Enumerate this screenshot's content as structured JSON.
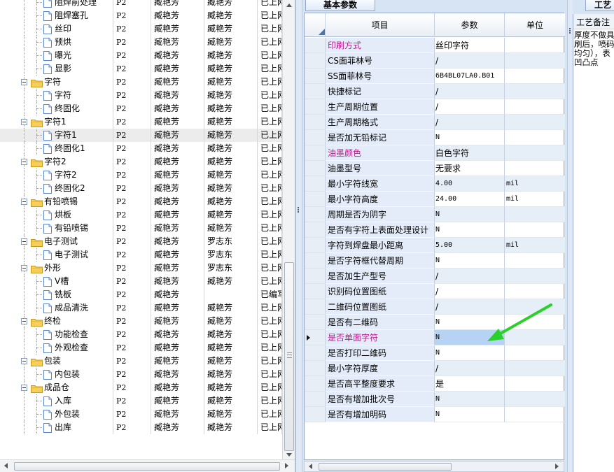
{
  "tree_rows": [
    {
      "label": "阻焊前处理",
      "level": 2,
      "icon": "doc",
      "c1": "P2",
      "c2": "臧艳芳",
      "c3": "臧艳芳",
      "c4": "已上网"
    },
    {
      "label": "阻焊塞孔",
      "level": 2,
      "icon": "doc",
      "c1": "P2",
      "c2": "臧艳芳",
      "c3": "臧艳芳",
      "c4": "已上网"
    },
    {
      "label": "丝印",
      "level": 2,
      "icon": "doc",
      "c1": "P2",
      "c2": "臧艳芳",
      "c3": "臧艳芳",
      "c4": "已上网"
    },
    {
      "label": "预烘",
      "level": 2,
      "icon": "doc",
      "c1": "P2",
      "c2": "臧艳芳",
      "c3": "臧艳芳",
      "c4": "已上网"
    },
    {
      "label": "曝光",
      "level": 2,
      "icon": "doc",
      "c1": "P2",
      "c2": "臧艳芳",
      "c3": "臧艳芳",
      "c4": "已上网"
    },
    {
      "label": "显影",
      "level": 2,
      "icon": "doc",
      "c1": "P2",
      "c2": "臧艳芳",
      "c3": "臧艳芳",
      "c4": "已上网"
    },
    {
      "label": "字符",
      "level": 1,
      "icon": "folder",
      "c1": "P2",
      "c2": "臧艳芳",
      "c3": "臧艳芳",
      "c4": "已上网"
    },
    {
      "label": "字符",
      "level": 2,
      "icon": "doc",
      "c1": "P2",
      "c2": "臧艳芳",
      "c3": "臧艳芳",
      "c4": "已上网"
    },
    {
      "label": "终固化",
      "level": 2,
      "icon": "doc",
      "c1": "P2",
      "c2": "臧艳芳",
      "c3": "臧艳芳",
      "c4": "已上网"
    },
    {
      "label": "字符1",
      "level": 1,
      "icon": "folder",
      "c1": "P2",
      "c2": "臧艳芳",
      "c3": "臧艳芳",
      "c4": "已上网"
    },
    {
      "label": "字符1",
      "level": 2,
      "icon": "doc",
      "c1": "P2",
      "c2": "臧艳芳",
      "c3": "臧艳芳",
      "c4": "已上网",
      "selected": true
    },
    {
      "label": "终固化1",
      "level": 2,
      "icon": "doc",
      "c1": "P2",
      "c2": "臧艳芳",
      "c3": "臧艳芳",
      "c4": "已上网"
    },
    {
      "label": "字符2",
      "level": 1,
      "icon": "folder",
      "c1": "P2",
      "c2": "臧艳芳",
      "c3": "臧艳芳",
      "c4": "已上网"
    },
    {
      "label": "字符2",
      "level": 2,
      "icon": "doc",
      "c1": "P2",
      "c2": "臧艳芳",
      "c3": "臧艳芳",
      "c4": "已上网"
    },
    {
      "label": "终固化2",
      "level": 2,
      "icon": "doc",
      "c1": "P2",
      "c2": "臧艳芳",
      "c3": "臧艳芳",
      "c4": "已上网"
    },
    {
      "label": "有铅喷锡",
      "level": 1,
      "icon": "folder",
      "c1": "P2",
      "c2": "臧艳芳",
      "c3": "臧艳芳",
      "c4": "已上网"
    },
    {
      "label": "烘板",
      "level": 2,
      "icon": "doc",
      "c1": "P2",
      "c2": "臧艳芳",
      "c3": "臧艳芳",
      "c4": "已上网"
    },
    {
      "label": "有铅喷锡",
      "level": 2,
      "icon": "doc",
      "c1": "P2",
      "c2": "臧艳芳",
      "c3": "臧艳芳",
      "c4": "已上网"
    },
    {
      "label": "电子测试",
      "level": 1,
      "icon": "folder",
      "c1": "P2",
      "c2": "臧艳芳",
      "c3": "罗志东",
      "c4": "已上网"
    },
    {
      "label": "电子测试",
      "level": 2,
      "icon": "doc",
      "c1": "P2",
      "c2": "臧艳芳",
      "c3": "罗志东",
      "c4": "已上网"
    },
    {
      "label": "外形",
      "level": 1,
      "icon": "folder",
      "c1": "P2",
      "c2": "臧艳芳",
      "c3": "罗志东",
      "c4": "已上网"
    },
    {
      "label": "V槽",
      "level": 2,
      "icon": "doc",
      "c1": "P2",
      "c2": "臧艳芳",
      "c3": "臧艳芳",
      "c4": "已上网"
    },
    {
      "label": "铣板",
      "level": 2,
      "icon": "doc",
      "c1": "P2",
      "c2": "臧艳芳",
      "c3": "",
      "c4": "已编写"
    },
    {
      "label": "成品清洗",
      "level": 2,
      "icon": "doc",
      "c1": "P2",
      "c2": "臧艳芳",
      "c3": "臧艳芳",
      "c4": "已上网"
    },
    {
      "label": "终检",
      "level": 1,
      "icon": "folder",
      "c1": "P2",
      "c2": "臧艳芳",
      "c3": "臧艳芳",
      "c4": "已上网"
    },
    {
      "label": "功能检查",
      "level": 2,
      "icon": "doc",
      "c1": "P2",
      "c2": "臧艳芳",
      "c3": "臧艳芳",
      "c4": "已上网"
    },
    {
      "label": "外观检查",
      "level": 2,
      "icon": "doc",
      "c1": "P2",
      "c2": "臧艳芳",
      "c3": "臧艳芳",
      "c4": "已上网"
    },
    {
      "label": "包装",
      "level": 1,
      "icon": "folder",
      "c1": "P2",
      "c2": "臧艳芳",
      "c3": "臧艳芳",
      "c4": "已上网"
    },
    {
      "label": "内包装",
      "level": 2,
      "icon": "doc",
      "c1": "P2",
      "c2": "臧艳芳",
      "c3": "臧艳芳",
      "c4": "已上网"
    },
    {
      "label": "成品仓",
      "level": 1,
      "icon": "folder",
      "c1": "P2",
      "c2": "臧艳芳",
      "c3": "臧艳芳",
      "c4": "已上网"
    },
    {
      "label": "入库",
      "level": 2,
      "icon": "doc",
      "c1": "P2",
      "c2": "臧艳芳",
      "c3": "臧艳芳",
      "c4": "已上网"
    },
    {
      "label": "外包装",
      "level": 2,
      "icon": "doc",
      "c1": "P2",
      "c2": "臧艳芳",
      "c3": "臧艳芳",
      "c4": "已上网"
    },
    {
      "label": "出库",
      "level": 2,
      "icon": "doc",
      "c1": "P2",
      "c2": "臧艳芳",
      "c3": "臧艳芳",
      "c4": "已上网"
    }
  ],
  "center": {
    "tab_label": "基本参数",
    "headers": {
      "item": "项目",
      "param": "参数",
      "unit": "单位"
    },
    "rows": [
      {
        "item": "印刷方式",
        "value": "丝印字符",
        "unit": "",
        "pink": true
      },
      {
        "item": "CS面菲林号",
        "value": "/",
        "unit": ""
      },
      {
        "item": "SS面菲林号",
        "value": "6B4BL07LA0.B01",
        "unit": "",
        "mono": true
      },
      {
        "item": "快捷标记",
        "value": "/",
        "unit": ""
      },
      {
        "item": "生产周期位置",
        "value": "/",
        "unit": ""
      },
      {
        "item": "生产周期格式",
        "value": "/",
        "unit": ""
      },
      {
        "item": "是否加无铅标记",
        "value": "N",
        "unit": "",
        "mono": true
      },
      {
        "item": "油墨颜色",
        "value": "白色字符",
        "unit": "",
        "pink": true
      },
      {
        "item": "油墨型号",
        "value": "无要求",
        "unit": ""
      },
      {
        "item": "最小字符线宽",
        "value": "4.00",
        "unit": "mil",
        "mono": true
      },
      {
        "item": "最小字符高度",
        "value": "24.00",
        "unit": "mil",
        "mono": true
      },
      {
        "item": "周期是否为阴字",
        "value": "N",
        "unit": "",
        "mono": true
      },
      {
        "item": "是否有字符上表面处理设计",
        "value": "N",
        "unit": "",
        "mono": true
      },
      {
        "item": "字符到焊盘最小距离",
        "value": "5.00",
        "unit": "mil",
        "mono": true
      },
      {
        "item": "是否字符框代替周期",
        "value": "N",
        "unit": "",
        "mono": true
      },
      {
        "item": "是否加生产型号",
        "value": "/",
        "unit": ""
      },
      {
        "item": "识别码位置图纸",
        "value": "/",
        "unit": ""
      },
      {
        "item": "二维码位置图纸",
        "value": "/",
        "unit": ""
      },
      {
        "item": "是否有二维码",
        "value": "N",
        "unit": "",
        "mono": true
      },
      {
        "item": "是否单面字符",
        "value": "N",
        "unit": "",
        "mono": true,
        "pink": true,
        "selected": true
      },
      {
        "item": "是否打印二维码",
        "value": "N",
        "unit": "",
        "mono": true
      },
      {
        "item": "最小字符厚度",
        "value": "/",
        "unit": ""
      },
      {
        "item": "是否高平整度要求",
        "value": "是",
        "unit": ""
      },
      {
        "item": "是否有增加批次号",
        "value": "N",
        "unit": "",
        "mono": true
      },
      {
        "item": "是否有增加明码",
        "value": "N",
        "unit": "",
        "mono": true
      }
    ]
  },
  "right": {
    "tab_label": "工艺",
    "title": "工艺备注",
    "text_lines": [
      "厚度不做具",
      "刷后，喷码",
      "均匀），表",
      "凹凸点"
    ]
  },
  "colors": {
    "pink": "#c3188f",
    "arrow": "#2bd12b",
    "selected_cell": "#b7d3f3"
  }
}
